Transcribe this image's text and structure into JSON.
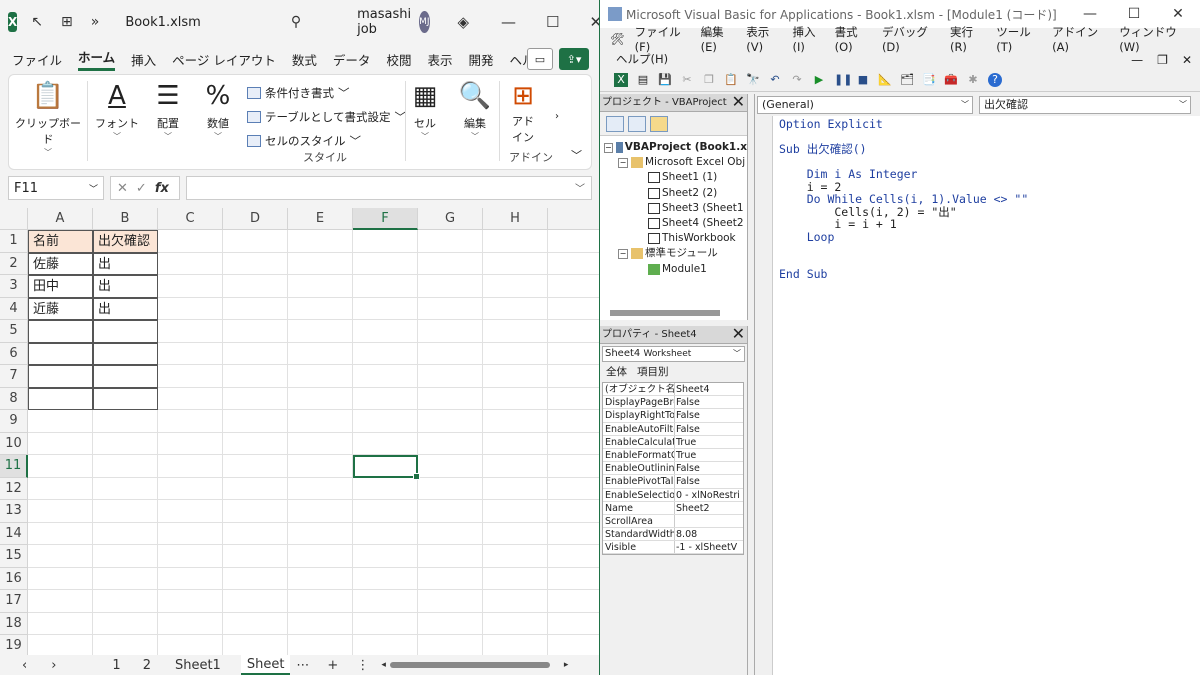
{
  "excel": {
    "title": {
      "logo": "X",
      "more": "»",
      "filename": "Book1.xlsm",
      "user": "masashi job",
      "avatar": "MJ"
    },
    "tabs": [
      "ファイル",
      "ホーム",
      "挿入",
      "ページ レイアウト",
      "数式",
      "データ",
      "校閲",
      "表示",
      "開発",
      "ヘルプ"
    ],
    "ribbon": {
      "clipboard": "クリップボード",
      "font": "フォント",
      "align": "配置",
      "number": "数値",
      "cond_format": "条件付き書式",
      "table_format": "テーブルとして書式設定",
      "cell_style": "セルのスタイル",
      "style_group": "スタイル",
      "cells": "セル",
      "edit": "編集",
      "addin": "アド イン",
      "addin_group": "アドイン"
    },
    "namebox": "F11",
    "fx": "fx",
    "columns": [
      "A",
      "B",
      "C",
      "D",
      "E",
      "F",
      "G",
      "H"
    ],
    "selected_col": "F",
    "selected_row": "11",
    "rows": [
      "1",
      "2",
      "3",
      "4",
      "5",
      "6",
      "7",
      "8",
      "9",
      "10",
      "11",
      "12",
      "13",
      "14",
      "15",
      "16",
      "17",
      "18",
      "19"
    ],
    "table": {
      "header": [
        "名前",
        "出欠確認"
      ],
      "body": [
        [
          "佐藤",
          "出"
        ],
        [
          "田中",
          "出"
        ],
        [
          "近藤",
          "出"
        ],
        [
          "",
          ""
        ],
        [
          "",
          ""
        ],
        [
          "",
          ""
        ],
        [
          "",
          ""
        ]
      ]
    },
    "sheet_tabs": [
      "1",
      "2",
      "Sheet1",
      "Sheet"
    ]
  },
  "vba": {
    "title": "Microsoft Visual Basic for Applications - Book1.xlsm - [Module1 (コード)]",
    "menu": [
      "ファイル(F)",
      "編集(E)",
      "表示(V)",
      "挿入(I)",
      "書式(O)",
      "デバッグ(D)",
      "実行(R)",
      "ツール(T)",
      "アドイン(A)",
      "ウィンドウ(W)"
    ],
    "menu2": "ヘルプ(H)",
    "project_title": "プロジェクト - VBAProject",
    "tree": [
      {
        "label": "VBAProject (Book1.x",
        "level": 0
      },
      {
        "label": "Microsoft Excel Obj",
        "level": 1
      },
      {
        "label": "Sheet1 (1)",
        "level": 2
      },
      {
        "label": "Sheet2 (2)",
        "level": 2
      },
      {
        "label": "Sheet3 (Sheet1",
        "level": 2
      },
      {
        "label": "Sheet4 (Sheet2",
        "level": 2
      },
      {
        "label": "ThisWorkbook",
        "level": 2
      },
      {
        "label": "標準モジュール",
        "level": 1
      },
      {
        "label": "Module1",
        "level": 2
      }
    ],
    "props_title": "プロパティ - Sheet4",
    "props_object": "Sheet4",
    "props_object_type": "Worksheet",
    "props_tabs": [
      "全体",
      "項目別"
    ],
    "props": [
      [
        "(オブジェクト名)",
        "Sheet4"
      ],
      [
        "DisplayPageBre",
        "False"
      ],
      [
        "DisplayRightTo",
        "False"
      ],
      [
        "EnableAutoFilte",
        "False"
      ],
      [
        "EnableCalculat",
        "True"
      ],
      [
        "EnableFormatC",
        "True"
      ],
      [
        "EnableOutlining",
        "False"
      ],
      [
        "EnablePivotTal",
        "False"
      ],
      [
        "EnableSelectio",
        "0 - xlNoRestri"
      ],
      [
        "Name",
        "Sheet2"
      ],
      [
        "ScrollArea",
        ""
      ],
      [
        "StandardWidth",
        "8.08"
      ],
      [
        "Visible",
        "-1 - xlSheetV"
      ]
    ],
    "combo_left": "(General)",
    "combo_right": "出欠確認",
    "code": [
      "Option Explicit",
      "",
      "Sub 出欠確認()",
      "",
      "    Dim i As Integer",
      "    i = 2",
      "    Do While Cells(i, 1).Value <> \"\"",
      "        Cells(i, 2) = \"出\"",
      "        i = i + 1",
      "    Loop",
      "",
      "",
      "End Sub"
    ]
  }
}
